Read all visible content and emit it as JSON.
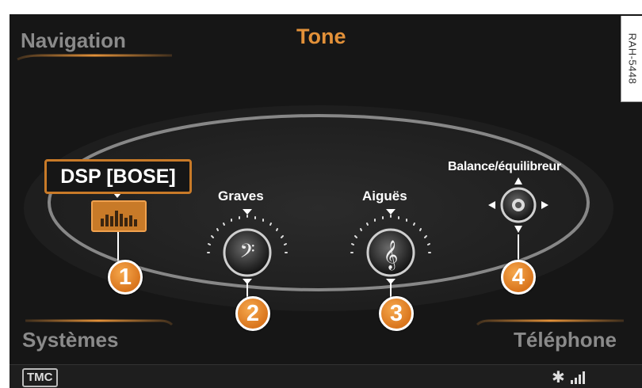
{
  "header": {
    "left_label": "Navigation",
    "title": "Tone"
  },
  "footer_menu": {
    "left_label": "Systèmes",
    "right_label": "Téléphone"
  },
  "dsp": {
    "label": "DSP [BOSE]",
    "icon": "equalizer-icon"
  },
  "controls": {
    "graves": {
      "label": "Graves",
      "icon": "bass-clef-icon"
    },
    "aigues": {
      "label": "Aiguës",
      "icon": "treble-clef-icon"
    },
    "balance": {
      "label": "Balance/équilibreur",
      "icon": "balance-joystick-icon"
    }
  },
  "callouts": [
    "1",
    "2",
    "3",
    "4"
  ],
  "statusbar": {
    "tmc": "TMC",
    "bluetooth_icon": "bluetooth-icon",
    "signal_icon": "signal-strength-icon"
  },
  "reference_code": "RAH-5448",
  "colors": {
    "accent": "#e39139",
    "badge": "#e0812a",
    "background": "#161616"
  }
}
